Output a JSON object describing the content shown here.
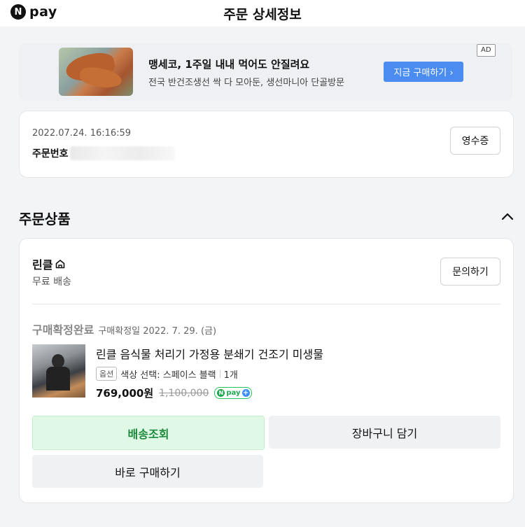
{
  "header": {
    "logo_n": "N",
    "logo_text": "pay",
    "title": "주문 상세정보"
  },
  "ad": {
    "badge": "AD",
    "title": "맹세코, 1주일 내내 먹어도 안질려요",
    "description": "전국 반건조생선 싹 다 모아둔, 생선마니아 단골방문",
    "button_label": "지금 구매하기 ›",
    "button_color": "#4a8cf0"
  },
  "order": {
    "date": "2022.07.24. 16:16:59",
    "number_label": "주문번호",
    "receipt_button": "영수증"
  },
  "products_section": {
    "title": "주문상품",
    "seller": {
      "name": "린클",
      "shipping": "무료 배송",
      "inquiry_button": "문의하기"
    },
    "status": {
      "main": "구매확정완료",
      "sub": "구매확정일 2022. 7. 29. (금)"
    },
    "product": {
      "name": "린클 음식물 처리기 가정용 분쇄기 건조기 미생물",
      "option_badge": "옵션",
      "option_text": "색상 선택: 스페이스 블랙",
      "quantity": "1개",
      "price": "769,000원",
      "original_price": "1,100,000",
      "npay_label": "pay"
    },
    "actions": {
      "track": "배송조회",
      "cart": "장바구니 담기",
      "buy_now": "바로 구매하기"
    },
    "accent_color": "#1b8a3a"
  }
}
